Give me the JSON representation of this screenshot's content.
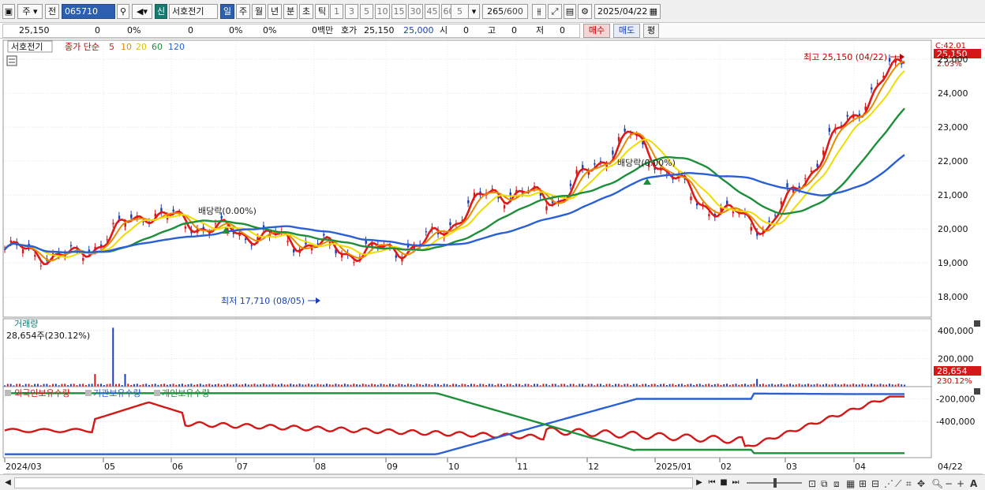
{
  "toolbar": {
    "market": "주",
    "prev_label": "전",
    "code": "065710",
    "stock_name": "서호전기",
    "credit_badge": "신",
    "periods": [
      "일",
      "주",
      "월",
      "년",
      "분",
      "초",
      "틱"
    ],
    "intervals": [
      "1",
      "3",
      "5",
      "10",
      "15",
      "30",
      "45",
      "60"
    ],
    "custom_interval": "5",
    "count_current": "265",
    "count_total": "/600",
    "date": "2025/04/22"
  },
  "quote": {
    "price": "25,150",
    "change": "0",
    "change_pct": "0%",
    "volume": "0",
    "volume_pct": "0%",
    "turnover_pct": "0%",
    "amount": "0백만",
    "ask_label": "호가",
    "ask_price": "25,150",
    "bid_price": "25,000",
    "open_label": "시",
    "open_value": "0",
    "high_label": "고",
    "high_value": "0",
    "low_label": "저",
    "low_value": "0",
    "buy_button": "매수",
    "sell_button": "매도",
    "eval_button": "평"
  },
  "price_panel": {
    "title": "서호전기",
    "indicator": "종가 단순",
    "ma_periods": [
      "5",
      "10",
      "20",
      "60",
      "120"
    ],
    "ma_colors": [
      "#e01818",
      "#e88a00",
      "#e8d800",
      "#1d8f3a",
      "#2a5fd6"
    ],
    "y_ticks": [
      "25,000",
      "24,000",
      "23,000",
      "22,000",
      "21,000",
      "20,000",
      "19,000",
      "18,000"
    ],
    "current_price_tag": "25,150",
    "current_change_tag": "2.03%",
    "top_clip_label": "C:42.01",
    "high_annotation": "최고 25,150 (04/22)",
    "low_annotation": "최저 17,710 (08/05)",
    "dividend_label_1": "배당락(0.00%)",
    "dividend_label_2": "배당락(0.00%)"
  },
  "volume_panel": {
    "title": "거래량",
    "info": "28,654주(230.12%)",
    "y_ticks": [
      "400,000",
      "200,000"
    ],
    "current_tag": "28,654",
    "current_pct_tag": "230.12%",
    "up_color": "#e01818",
    "down_color": "#1b3fb8"
  },
  "holdings_panel": {
    "legend": [
      "외국인보유수량",
      "기관보유수량",
      "개인보유수량"
    ],
    "colors": [
      "#d41818",
      "#2a5fd6",
      "#1d8f3a"
    ],
    "y_ticks": [
      "-200,000",
      "-400,000"
    ]
  },
  "x_axis": {
    "labels": [
      "2024/03",
      "05",
      "06",
      "07",
      "08",
      "09",
      "10",
      "11",
      "12",
      "2025/01",
      "02",
      "03",
      "04"
    ],
    "right_label": "04/22"
  },
  "chart_data": {
    "type": "line",
    "price_series": {
      "name": "서호전기",
      "x": [
        "2024-03",
        "2024-04",
        "2024-05",
        "2024-06",
        "2024-07",
        "2024-08",
        "2024-09",
        "2024-10",
        "2024-11",
        "2024-12",
        "2025-01",
        "2025-02",
        "2025-03",
        "2025-04"
      ],
      "close": [
        19400,
        19150,
        20500,
        20000,
        19700,
        19300,
        19500,
        21100,
        20900,
        22800,
        20800,
        20050,
        22800,
        25150
      ]
    },
    "ma_series": [
      {
        "name": "5",
        "values": [
          19400,
          19150,
          20500,
          20000,
          19700,
          19300,
          19500,
          21100,
          20900,
          22800,
          20800,
          20050,
          22800,
          25150
        ]
      },
      {
        "name": "120",
        "values": [
          19050,
          19100,
          19200,
          19400,
          19450,
          19500,
          19550,
          19800,
          20200,
          20600,
          20800,
          20900,
          21300,
          21950
        ]
      }
    ],
    "price_ylim": [
      17400,
      25400
    ],
    "volume_ylim": [
      0,
      450000
    ],
    "holdings_ylim": [
      -720000,
      -120000
    ],
    "high": {
      "value": 25150,
      "date": "04/22"
    },
    "low": {
      "value": 17710,
      "date": "08/05"
    }
  },
  "scrollbar": {
    "zoom_minus": "−",
    "zoom_plus": "+",
    "font_button": "A"
  }
}
